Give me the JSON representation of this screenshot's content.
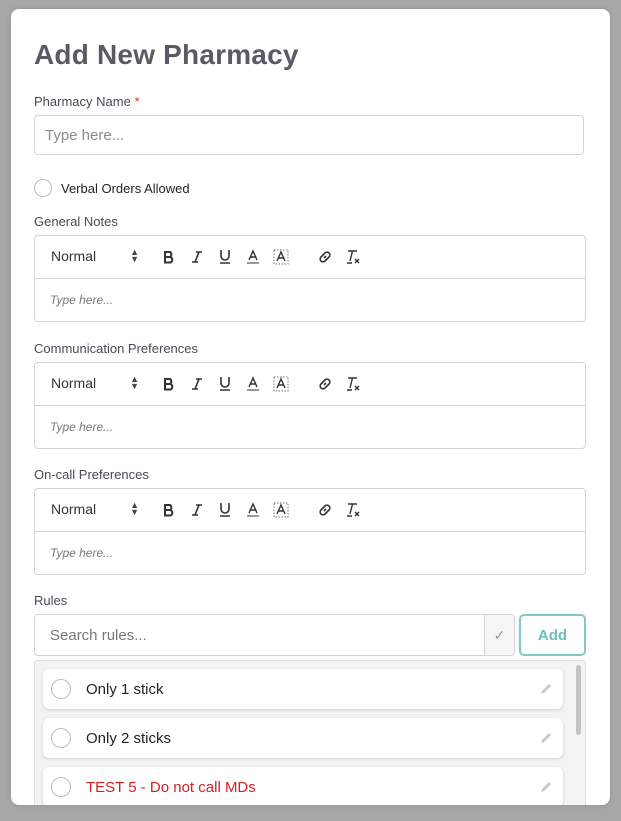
{
  "modal": {
    "title": "Add New Pharmacy"
  },
  "pharmacy_name": {
    "label": "Pharmacy Name",
    "required_mark": "*",
    "placeholder": "Type here...",
    "value": ""
  },
  "verbal_orders": {
    "label": "Verbal Orders Allowed",
    "checked": false
  },
  "editors": [
    {
      "label": "General Notes",
      "format_select": "Normal",
      "placeholder": "Type here..."
    },
    {
      "label": "Communication Preferences",
      "format_select": "Normal",
      "placeholder": "Type here..."
    },
    {
      "label": "On-call Preferences",
      "format_select": "Normal",
      "placeholder": "Type here..."
    }
  ],
  "toolbar_icons": [
    "bold-icon",
    "italic-icon",
    "underline-icon",
    "font-color-icon",
    "background-color-icon",
    "link-icon",
    "clear-format-icon"
  ],
  "rules": {
    "label": "Rules",
    "search_placeholder": "Search rules...",
    "confirm_icon": "check-icon",
    "add_label": "Add",
    "accent_color": "#6cbfb4",
    "items": [
      {
        "text": "Only 1 stick",
        "highlight": false
      },
      {
        "text": "Only 2 sticks",
        "highlight": false
      },
      {
        "text": "TEST 5 - Do not call MDs",
        "highlight": true,
        "color": "#d42020"
      }
    ]
  }
}
